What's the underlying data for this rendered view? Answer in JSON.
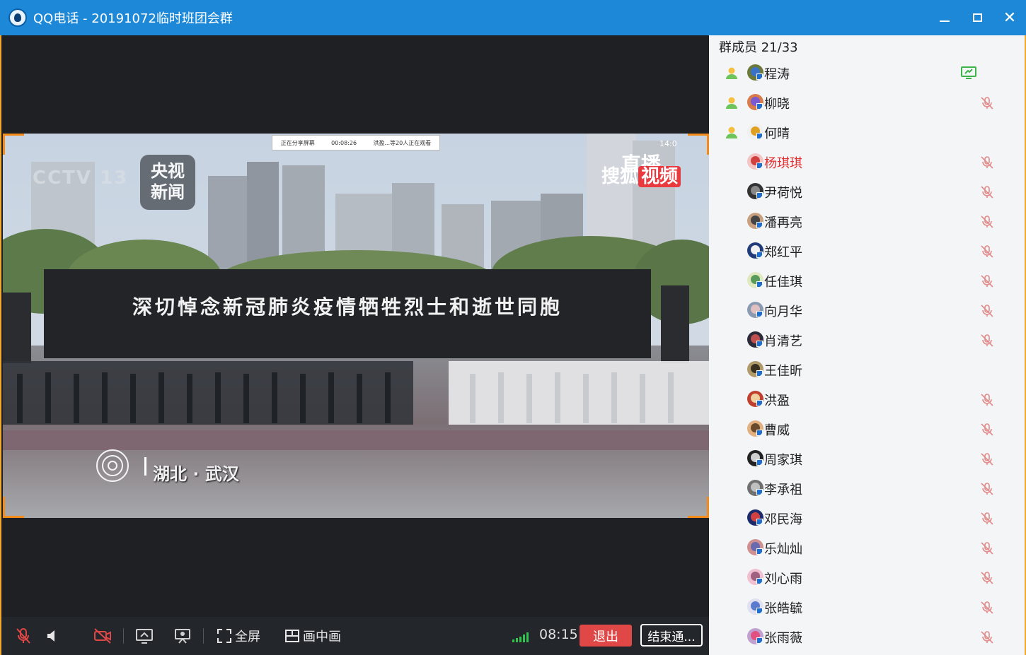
{
  "window": {
    "title": "QQ电话 - 20191072临时班团会群",
    "app_icon": "qq-icon"
  },
  "share": {
    "badge_left": "正在分享屏幕",
    "badge_time": "00:08:26",
    "badge_right": "洪盈...等20人正在观看",
    "banner_text": "深切悼念新冠肺炎疫情牺牲烈士和逝世同胞",
    "cctv_logo": "CCTV 13",
    "news_logo_line1": "央视",
    "news_logo_line2": "新闻",
    "live_label": "直播",
    "sohu_label": "搜狐",
    "sohu_video": "视频",
    "live_time": "14:0",
    "location": "湖北 · 武汉"
  },
  "toolbar": {
    "fullscreen_label": "全屏",
    "pip_label": "画中画",
    "timer": "08:15",
    "exit_label": "退出",
    "end_label": "结束通..."
  },
  "colors": {
    "titlebar": "#1e88d8",
    "exit": "#e04848",
    "signal": "#32c24d",
    "active_member": "#e33030",
    "frame_accent": "#f28c1c"
  },
  "members": {
    "header": "群成员 21/33",
    "list": [
      {
        "name": "程涛",
        "host": true,
        "status": "screen-share-icon",
        "active": false,
        "c1": "#6b7a3a",
        "c2": "#3a72c8"
      },
      {
        "name": "柳晓",
        "host": true,
        "status": "mic-muted-icon",
        "active": false,
        "c1": "#d87a4a",
        "c2": "#7a5ad0"
      },
      {
        "name": "何晴",
        "host": true,
        "status": "",
        "active": false,
        "c1": "#f0f0f0",
        "c2": "#e0a020"
      },
      {
        "name": "杨琪琪",
        "host": false,
        "status": "mic-muted-icon",
        "active": true,
        "c1": "#f2c4c4",
        "c2": "#d04040"
      },
      {
        "name": "尹荷悦",
        "host": false,
        "status": "mic-muted-icon",
        "active": false,
        "c1": "#333333",
        "c2": "#888888"
      },
      {
        "name": "潘再亮",
        "host": false,
        "status": "mic-muted-icon",
        "active": false,
        "c1": "#c8a080",
        "c2": "#444444"
      },
      {
        "name": "郑红平",
        "host": false,
        "status": "mic-muted-icon",
        "active": false,
        "c1": "#203a7a",
        "c2": "#f0f0f0"
      },
      {
        "name": "任佳琪",
        "host": false,
        "status": "mic-muted-icon",
        "active": false,
        "c1": "#e0e8c0",
        "c2": "#5a9a5a"
      },
      {
        "name": "向月华",
        "host": false,
        "status": "mic-muted-icon",
        "active": false,
        "c1": "#8a9ab0",
        "c2": "#e0c0c0"
      },
      {
        "name": "肖清艺",
        "host": false,
        "status": "mic-muted-icon",
        "active": false,
        "c1": "#2a2a3a",
        "c2": "#c05050"
      },
      {
        "name": "王佳昕",
        "host": false,
        "status": "",
        "active": false,
        "c1": "#b09a6a",
        "c2": "#3a3020"
      },
      {
        "name": "洪盈",
        "host": false,
        "status": "mic-muted-icon",
        "active": false,
        "c1": "#c04030",
        "c2": "#f0d0a0"
      },
      {
        "name": "曹威",
        "host": false,
        "status": "mic-muted-icon",
        "active": false,
        "c1": "#e0b080",
        "c2": "#6a4a2a"
      },
      {
        "name": "周家琪",
        "host": false,
        "status": "mic-muted-icon",
        "active": false,
        "c1": "#222222",
        "c2": "#d0d0d0"
      },
      {
        "name": "李承祖",
        "host": false,
        "status": "mic-muted-icon",
        "active": false,
        "c1": "#707070",
        "c2": "#c0c0c0"
      },
      {
        "name": "邓民海",
        "host": false,
        "status": "mic-muted-icon",
        "active": false,
        "c1": "#1a2a6a",
        "c2": "#d04040"
      },
      {
        "name": "乐灿灿",
        "host": false,
        "status": "mic-muted-icon",
        "active": false,
        "c1": "#d09090",
        "c2": "#6a6ab0"
      },
      {
        "name": "刘心雨",
        "host": false,
        "status": "mic-muted-icon",
        "active": false,
        "c1": "#f0c0d0",
        "c2": "#a06080"
      },
      {
        "name": "张皓毓",
        "host": false,
        "status": "mic-muted-icon",
        "active": false,
        "c1": "#e0e0f0",
        "c2": "#5a7ad0"
      },
      {
        "name": "张雨薇",
        "host": false,
        "status": "mic-muted-icon",
        "active": false,
        "c1": "#c0a0d0",
        "c2": "#e05080"
      }
    ]
  }
}
